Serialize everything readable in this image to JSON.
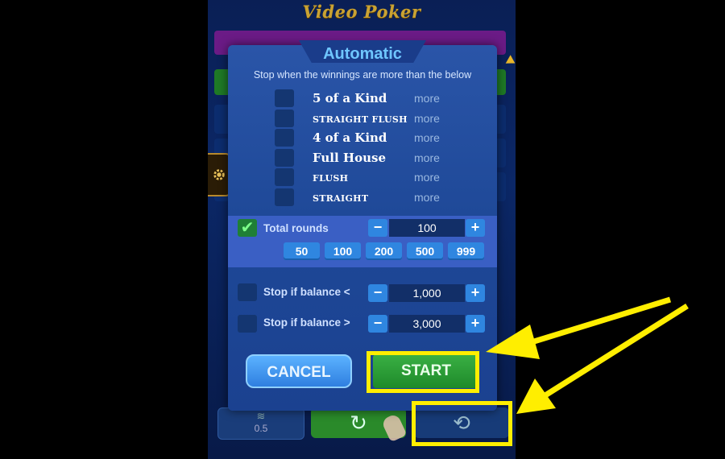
{
  "game": {
    "title": "Video Poker"
  },
  "dialog": {
    "title": "Automatic",
    "subtitle": "Stop when the winnings are more than the below",
    "hands": [
      {
        "label": "5 of a Kind",
        "more": "more",
        "size": "big"
      },
      {
        "label": "STRAIGHT FLUSH",
        "more": "more",
        "size": "small"
      },
      {
        "label": "4 of a Kind",
        "more": "more",
        "size": "big"
      },
      {
        "label": "Full House",
        "more": "more",
        "size": "big"
      },
      {
        "label": "FLUSH",
        "more": "more",
        "size": "small"
      },
      {
        "label": "STRAIGHT",
        "more": "more",
        "size": "small"
      }
    ],
    "total_rounds": {
      "label": "Total rounds",
      "checked": true,
      "value": "100",
      "minus": "−",
      "plus": "+"
    },
    "presets": [
      "50",
      "100",
      "200",
      "500",
      "999"
    ],
    "stop_below": {
      "label": "Stop if balance <",
      "checked": false,
      "value": "1,000",
      "minus": "−",
      "plus": "+"
    },
    "stop_above": {
      "label": "Stop if balance >",
      "checked": false,
      "value": "3,000",
      "minus": "−",
      "plus": "+"
    },
    "cancel_label": "CANCEL",
    "start_label": "START"
  },
  "bottom": {
    "bet_value": "0.5"
  },
  "colors": {
    "highlight": "#ffee00",
    "start_green": "#1e8a2a",
    "cancel_blue": "#2f7fe0"
  }
}
